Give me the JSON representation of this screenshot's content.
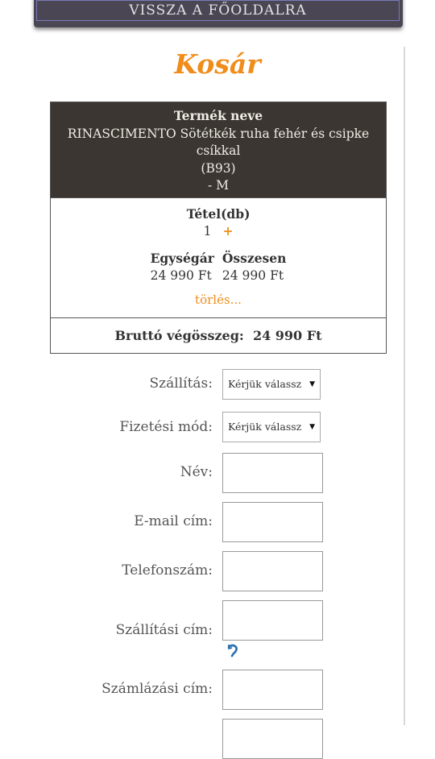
{
  "nav": {
    "back_label": "VISSZA A FŐOLDALRA"
  },
  "page": {
    "title": "Kosár"
  },
  "cart": {
    "header_label": "Termék neve",
    "product_name": "RINASCIMENTO Sötétkék ruha fehér és csipke csíkkal",
    "product_code": "(B93)",
    "size": "- M",
    "qty_label": "Tétel(db)",
    "qty_value": "1",
    "plus_label": "+",
    "unit_price_label": "Egységár",
    "unit_price": "24 990 Ft",
    "total_label": "Összesen",
    "total": "24 990 Ft",
    "delete_label": "törlés...",
    "gross_total_label": "Bruttó végösszeg:",
    "gross_total": "24 990 Ft"
  },
  "form": {
    "shipping_label": "Szállítás:",
    "shipping_value": "Kérjük válassz",
    "payment_label": "Fizetési mód:",
    "payment_value": "Kérjük válassz",
    "name_label": "Név:",
    "email_label": "E-mail cím:",
    "phone_label": "Telefonszám:",
    "shipping_address_label": "Szállítási cím:",
    "billing_address_label": "Számlázási cím:"
  },
  "colors": {
    "accent": "#f08c1a",
    "header_bg": "#3b3631",
    "nav_bg": "#4a4654",
    "refresh_icon": "#2a6fb0"
  },
  "icons": {
    "dropdown": "triangle-down-icon",
    "refresh": "refresh-icon"
  }
}
